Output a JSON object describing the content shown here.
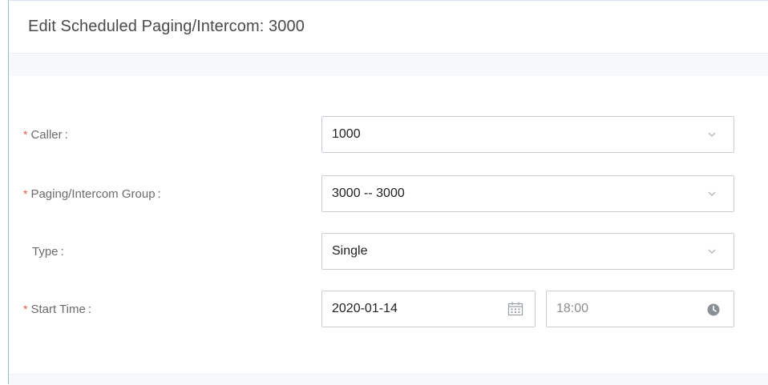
{
  "dialog": {
    "title": "Edit Scheduled Paging/Intercom: 3000"
  },
  "form": {
    "caller": {
      "label": "Caller",
      "required": true,
      "value": "1000"
    },
    "group": {
      "label": "Paging/Intercom Group",
      "required": true,
      "value": "3000 -- 3000"
    },
    "type": {
      "label": "Type",
      "required": false,
      "value": "Single"
    },
    "start_time": {
      "label": "Start Time",
      "required": true,
      "date": "2020-01-14",
      "time": "18:00"
    }
  },
  "colors": {
    "required_asterisk": "#e05a4f",
    "border": "#c9ced4",
    "label": "#6b6b6b"
  },
  "icons": {
    "dropdown": "chevron-down-icon",
    "date": "calendar-icon",
    "time": "clock-icon"
  }
}
